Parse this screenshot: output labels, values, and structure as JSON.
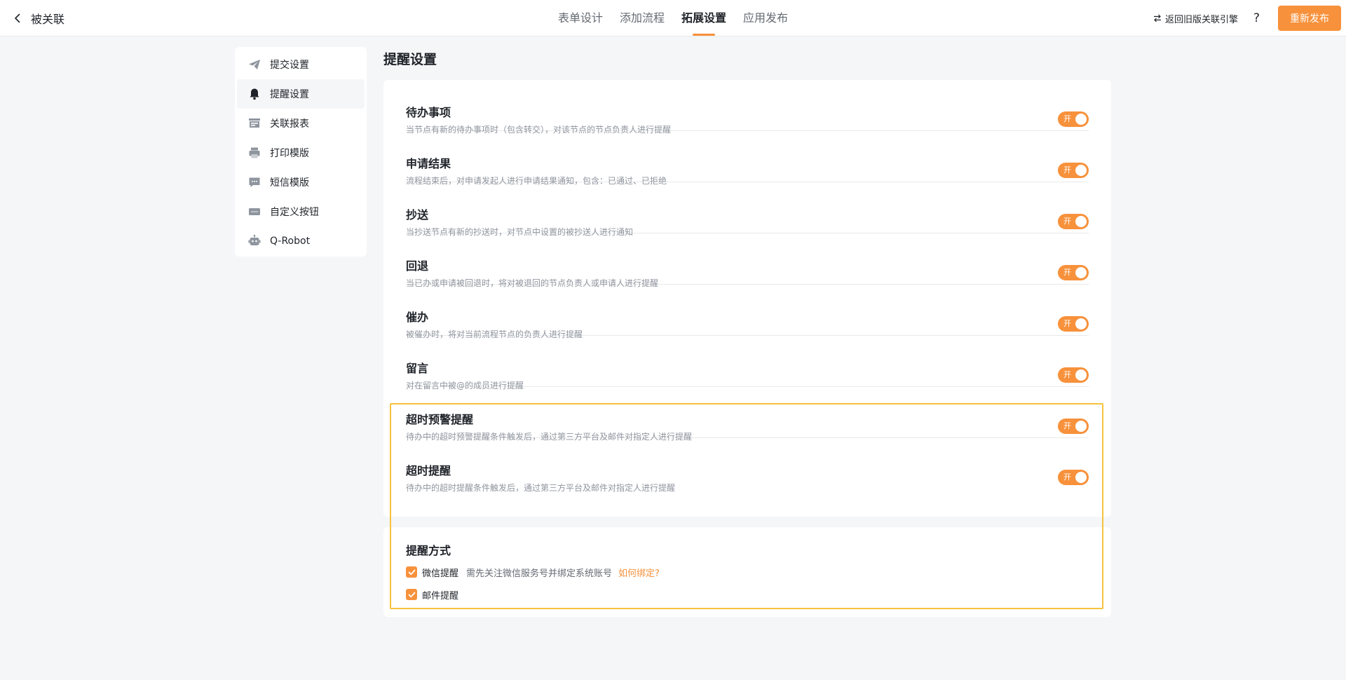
{
  "header": {
    "back_label": "被关联",
    "tabs": [
      {
        "label": "表单设计",
        "active": false
      },
      {
        "label": "添加流程",
        "active": false
      },
      {
        "label": "拓展设置",
        "active": true
      },
      {
        "label": "应用发布",
        "active": false
      }
    ],
    "old_version_label": "返回旧版关联引擎",
    "help_label": "?",
    "publish_label": "重新发布"
  },
  "sidebar": {
    "items": [
      {
        "label": "提交设置",
        "icon": "send-icon",
        "active": false
      },
      {
        "label": "提醒设置",
        "icon": "bell-icon",
        "active": true
      },
      {
        "label": "关联报表",
        "icon": "report-icon",
        "active": false
      },
      {
        "label": "打印模版",
        "icon": "printer-icon",
        "active": false
      },
      {
        "label": "短信模版",
        "icon": "message-icon",
        "active": false
      },
      {
        "label": "自定义按钮",
        "icon": "button-icon",
        "active": false
      },
      {
        "label": "Q-Robot",
        "icon": "robot-icon",
        "active": false
      }
    ]
  },
  "main": {
    "title": "提醒设置",
    "reminders": [
      {
        "title": "待办事项",
        "desc": "当节点有新的待办事项时（包含转交），对该节点的节点负责人进行提醒",
        "switch_label": "开",
        "enabled": true
      },
      {
        "title": "申请结果",
        "desc": "流程结束后，对申请发起人进行申请结果通知，包含：已通过、已拒绝",
        "switch_label": "开",
        "enabled": true
      },
      {
        "title": "抄送",
        "desc": "当抄送节点有新的抄送时，对节点中设置的被抄送人进行通知",
        "switch_label": "开",
        "enabled": true
      },
      {
        "title": "回退",
        "desc": "当已办或申请被回退时，将对被退回的节点负责人或申请人进行提醒",
        "switch_label": "开",
        "enabled": true
      },
      {
        "title": "催办",
        "desc": "被催办时，将对当前流程节点的负责人进行提醒",
        "switch_label": "开",
        "enabled": true
      },
      {
        "title": "留言",
        "desc": "对在留言中被@的成员进行提醒",
        "switch_label": "开",
        "enabled": true
      },
      {
        "title": "超时预警提醒",
        "desc": "待办中的超时预警提醒条件触发后，通过第三方平台及邮件对指定人进行提醒",
        "switch_label": "开",
        "enabled": true
      },
      {
        "title": "超时提醒",
        "desc": "待办中的超时提醒条件触发后，通过第三方平台及邮件对指定人进行提醒",
        "switch_label": "开",
        "enabled": true
      }
    ],
    "method": {
      "title": "提醒方式",
      "wechat_label": "微信提醒",
      "wechat_hint": "需先关注微信服务号并绑定系统账号",
      "wechat_link": "如何绑定?",
      "email_label": "邮件提醒"
    }
  },
  "colors": {
    "accent": "#f7913b",
    "highlight_frame": "#f7c23c"
  }
}
